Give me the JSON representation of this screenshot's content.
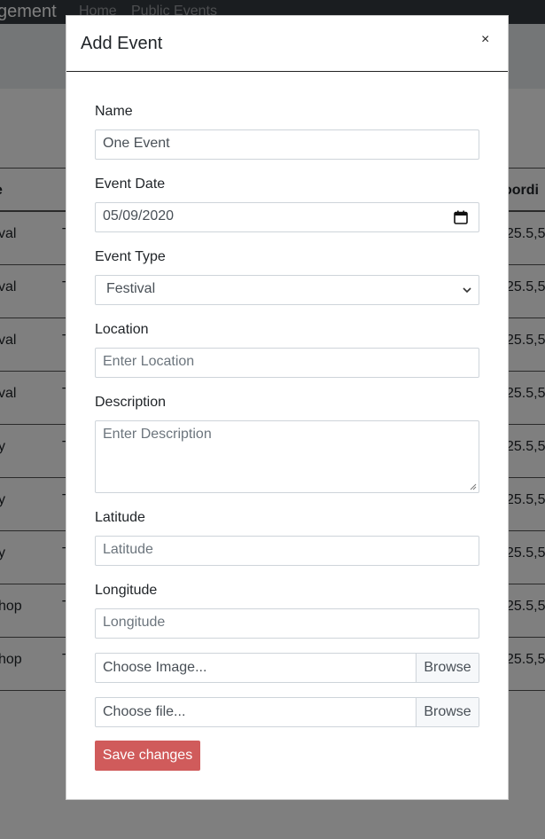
{
  "navbar": {
    "brand": "gement",
    "links": [
      "Home",
      "Public Events"
    ]
  },
  "table": {
    "headers": [
      "e",
      "oordi"
    ],
    "rows": [
      {
        "c1": "val",
        "c2": "T",
        "c3": "25.5,5"
      },
      {
        "c1": "val",
        "c2": "T",
        "c3": "25.5,5"
      },
      {
        "c1": "val",
        "c2": "T",
        "c3": "25.5,5"
      },
      {
        "c1": "val",
        "c2": "T",
        "c3": "25.5,5"
      },
      {
        "c1": "y",
        "c2": "T",
        "c3": "25.5,5"
      },
      {
        "c1": "y",
        "c2": "T",
        "c3": "25.5,5"
      },
      {
        "c1": "y",
        "c2": "T",
        "c3": "25.5,5"
      },
      {
        "c1": "hop",
        "c2": "T",
        "c3": "25.5,5"
      },
      {
        "c1": "hop",
        "c2": "T",
        "c3": "25.5,5"
      }
    ]
  },
  "modal": {
    "title": "Add Event",
    "close": "×",
    "fields": {
      "name": {
        "label": "Name",
        "value": "One Event"
      },
      "event_date": {
        "label": "Event Date",
        "value": "05/09/2020"
      },
      "event_type": {
        "label": "Event Type",
        "value": "Festival"
      },
      "location": {
        "label": "Location",
        "placeholder": "Enter Location"
      },
      "description": {
        "label": "Description",
        "placeholder": "Enter Description"
      },
      "latitude": {
        "label": "Latitude",
        "placeholder": "Latitude"
      },
      "longitude": {
        "label": "Longitude",
        "placeholder": "Longitude"
      }
    },
    "image_upload": {
      "label": "Choose Image...",
      "button": "Browse"
    },
    "file_upload": {
      "label": "Choose file...",
      "button": "Browse"
    },
    "save_button": "Save changes"
  },
  "colors": {
    "navbar_bg": "#343a40",
    "save_button_bg": "#d05b5b",
    "backdrop": "rgba(0,0,0,0.5)"
  },
  "icons": [
    "calendar-icon",
    "chevron-down-icon",
    "resize-handle-icon",
    "close-icon"
  ]
}
